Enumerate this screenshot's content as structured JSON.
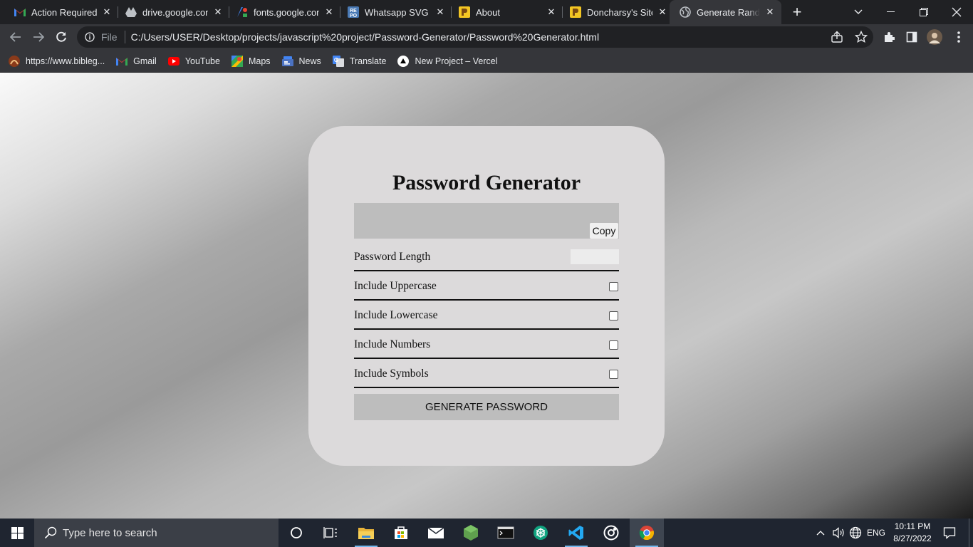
{
  "browser": {
    "tabs": [
      {
        "title": "Action Required:",
        "icon": "gmail-icon"
      },
      {
        "title": "drive.google.com",
        "icon": "drive-icon"
      },
      {
        "title": "fonts.google.com",
        "icon": "fonts-icon"
      },
      {
        "title": "Whatsapp SVG Ve",
        "icon": "repo-icon"
      },
      {
        "title": "About",
        "icon": "site-icon"
      },
      {
        "title": "Doncharsy's Site",
        "icon": "site-icon"
      },
      {
        "title": "Generate Random",
        "icon": "globe-icon",
        "active": true
      }
    ],
    "new_tab_label": "+",
    "address": {
      "scheme": "File",
      "url": "C:/Users/USER/Desktop/projects/javascript%20project/Password-Generator/Password%20Generator.html"
    },
    "bookmarks": [
      {
        "label": "https://www.bibleg...",
        "icon": "bible-icon"
      },
      {
        "label": "Gmail",
        "icon": "gmail-icon"
      },
      {
        "label": "YouTube",
        "icon": "youtube-icon"
      },
      {
        "label": "Maps",
        "icon": "maps-icon"
      },
      {
        "label": "News",
        "icon": "news-icon"
      },
      {
        "label": "Translate",
        "icon": "translate-icon"
      },
      {
        "label": "New Project – Vercel",
        "icon": "vercel-icon"
      }
    ]
  },
  "app": {
    "title": "Password Generator",
    "result_value": "",
    "copy_label": "Copy",
    "length": {
      "label": "Password Length",
      "value": ""
    },
    "options": [
      {
        "label": "Include Uppercase",
        "checked": false
      },
      {
        "label": "Include Lowercase",
        "checked": false
      },
      {
        "label": "Include Numbers",
        "checked": false
      },
      {
        "label": "Include Symbols",
        "checked": false
      }
    ],
    "generate_label": "GENERATE PASSWORD"
  },
  "taskbar": {
    "search_placeholder": "Type here to search",
    "language": "ENG",
    "time": "10:11 PM",
    "date": "8/27/2022"
  },
  "colors": {
    "chrome_dark": "#202124",
    "chrome_toolbar": "#35363a",
    "card": "#dcdadb",
    "field": "#bdbdbd",
    "taskbar": "#1f2530"
  }
}
